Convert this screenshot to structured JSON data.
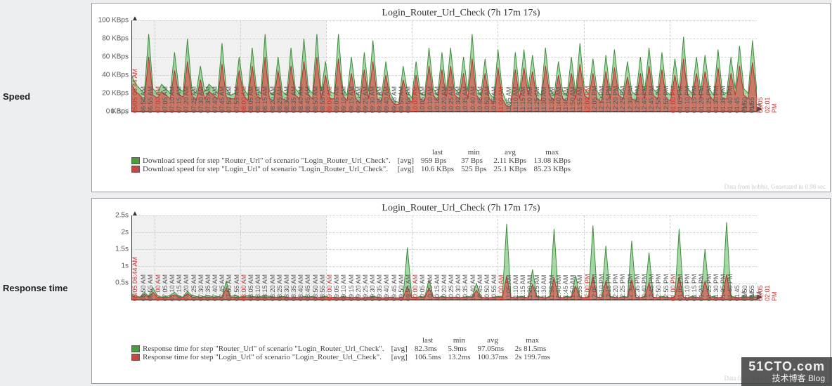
{
  "labels": {
    "speed": "Speed",
    "response": "Response time"
  },
  "brand": {
    "line1": "51CTO.com",
    "line2": "技术博客  Blog"
  },
  "watermark": "Data from hobbit, Generated in 0.98 sec",
  "chart_data": [
    {
      "type": "area",
      "title": "Login_Router_Url_Check (7h 17m 17s)",
      "ylabel": "Speed",
      "ylim": [
        0,
        100
      ],
      "yunit": "KBps",
      "yticks": [
        0,
        20,
        40,
        60,
        80,
        100
      ],
      "x_start": "05/05 06:44 AM",
      "x_end": "05/05 02:01 PM",
      "x_span_minutes": 437,
      "grey_until_minute": 136,
      "xticks": [
        {
          "label": "05/05 06:44 AM",
          "color": "red",
          "minute": 0
        },
        {
          "label": "06:50 AM",
          "minute": 6
        },
        {
          "label": "06:55 AM",
          "minute": 11
        },
        {
          "label": "07:00 AM",
          "color": "red",
          "minute": 16
        },
        {
          "label": "07:05 AM",
          "minute": 21
        },
        {
          "label": "07:10 AM",
          "minute": 26
        },
        {
          "label": "07:15 AM",
          "minute": 31
        },
        {
          "label": "07:20 AM",
          "minute": 36
        },
        {
          "label": "07:25 AM",
          "minute": 41
        },
        {
          "label": "07:30 AM",
          "minute": 46
        },
        {
          "label": "07:35 AM",
          "minute": 51
        },
        {
          "label": "07:40 AM",
          "minute": 56
        },
        {
          "label": "07:45 AM",
          "minute": 61
        },
        {
          "label": "07:50 AM",
          "minute": 66
        },
        {
          "label": "07:55 AM",
          "minute": 71
        },
        {
          "label": "08:00 AM",
          "color": "red",
          "minute": 76
        },
        {
          "label": "08:05 AM",
          "minute": 81
        },
        {
          "label": "08:10 AM",
          "minute": 86
        },
        {
          "label": "08:15 AM",
          "minute": 91
        },
        {
          "label": "08:20 AM",
          "minute": 96
        },
        {
          "label": "08:25 AM",
          "minute": 101
        },
        {
          "label": "08:30 AM",
          "minute": 106
        },
        {
          "label": "08:35 AM",
          "minute": 111
        },
        {
          "label": "08:40 AM",
          "minute": 116
        },
        {
          "label": "08:45 AM",
          "minute": 121
        },
        {
          "label": "08:50 AM",
          "minute": 126
        },
        {
          "label": "08:55 AM",
          "minute": 131
        },
        {
          "label": "09:00 AM",
          "color": "red",
          "minute": 136
        },
        {
          "label": "09:05 AM",
          "minute": 141
        },
        {
          "label": "09:10 AM",
          "minute": 146
        },
        {
          "label": "09:15 AM",
          "minute": 151
        },
        {
          "label": "09:20 AM",
          "minute": 156
        },
        {
          "label": "09:25 AM",
          "minute": 161
        },
        {
          "label": "09:30 AM",
          "minute": 166
        },
        {
          "label": "09:35 AM",
          "minute": 171
        },
        {
          "label": "09:40 AM",
          "minute": 176
        },
        {
          "label": "09:45 AM",
          "minute": 181
        },
        {
          "label": "09:50 AM",
          "minute": 186
        },
        {
          "label": "09:55 AM",
          "minute": 191
        },
        {
          "label": "10:00 AM",
          "color": "red",
          "minute": 196
        },
        {
          "label": "10:05 AM",
          "minute": 201
        },
        {
          "label": "10:10 AM",
          "minute": 206
        },
        {
          "label": "10:15 AM",
          "minute": 211
        },
        {
          "label": "10:20 AM",
          "minute": 216
        },
        {
          "label": "10:25 AM",
          "minute": 221
        },
        {
          "label": "10:30 AM",
          "minute": 226
        },
        {
          "label": "10:35 AM",
          "minute": 231
        },
        {
          "label": "10:40 AM",
          "minute": 236
        },
        {
          "label": "10:45 AM",
          "minute": 241
        },
        {
          "label": "10:50 AM",
          "minute": 246
        },
        {
          "label": "10:55 AM",
          "minute": 251
        },
        {
          "label": "11:00 AM",
          "color": "red",
          "minute": 256
        },
        {
          "label": "11:05 AM",
          "minute": 261
        },
        {
          "label": "11:10 AM",
          "minute": 266
        },
        {
          "label": "11:15 AM",
          "minute": 271
        },
        {
          "label": "11:20 AM",
          "minute": 276
        },
        {
          "label": "11:25 AM",
          "minute": 281
        },
        {
          "label": "11:30 AM",
          "minute": 286
        },
        {
          "label": "11:35 AM",
          "minute": 291
        },
        {
          "label": "11:40 AM",
          "minute": 296
        },
        {
          "label": "11:45 AM",
          "minute": 301
        },
        {
          "label": "11:50 AM",
          "minute": 306
        },
        {
          "label": "11:55 AM",
          "minute": 311
        },
        {
          "label": "12:00 PM",
          "color": "red",
          "minute": 316
        },
        {
          "label": "12:05 PM",
          "minute": 321
        },
        {
          "label": "12:10 PM",
          "minute": 326
        },
        {
          "label": "12:15 PM",
          "minute": 331
        },
        {
          "label": "12:20 PM",
          "minute": 336
        },
        {
          "label": "12:25 PM",
          "minute": 341
        },
        {
          "label": "12:30 PM",
          "minute": 346
        },
        {
          "label": "12:35 PM",
          "minute": 351
        },
        {
          "label": "12:40 PM",
          "minute": 356
        },
        {
          "label": "12:45 PM",
          "minute": 361
        },
        {
          "label": "12:50 PM",
          "minute": 366
        },
        {
          "label": "12:55 PM",
          "minute": 371
        },
        {
          "label": "01:00 PM",
          "color": "red",
          "minute": 376
        },
        {
          "label": "01:05 PM",
          "minute": 381
        },
        {
          "label": "01:10 PM",
          "minute": 386
        },
        {
          "label": "01:15 PM",
          "minute": 391
        },
        {
          "label": "01:20 PM",
          "minute": 396
        },
        {
          "label": "01:25 PM",
          "minute": 401
        },
        {
          "label": "01:30 PM",
          "minute": 406
        },
        {
          "label": "01:35 PM",
          "minute": 411
        },
        {
          "label": "01:40 PM",
          "minute": 416
        },
        {
          "label": "01:45 PM",
          "minute": 421
        },
        {
          "label": "01:50 PM",
          "minute": 426
        },
        {
          "label": "01:55 PM",
          "minute": 431
        },
        {
          "label": "05/05 02:01 PM",
          "color": "red",
          "minute": 437
        }
      ],
      "series": [
        {
          "name": "Download speed for step \"Router_Url\" of scenario \"Login_Router_Url_Check\".",
          "color": "#4a9e3a",
          "stats": {
            "last": "959 Bps",
            "min": "37 Bps",
            "avg": "2.11 KBps",
            "max": "13.08 KBps"
          }
        },
        {
          "name": "Download speed for step \"Login_Url\" of scenario \"Login_Router_Url_Check\".",
          "color": "#d9534f",
          "stats": {
            "last": "10.6 KBps",
            "min": "525 Bps",
            "avg": "25.1 KBps",
            "max": "85.23 KBps"
          }
        }
      ],
      "stat_headers": [
        "last",
        "min",
        "avg",
        "max"
      ],
      "stat_label": "[avg]",
      "green_values": [
        40,
        30,
        25,
        20,
        85,
        25,
        20,
        30,
        25,
        20,
        65,
        25,
        22,
        80,
        25,
        20,
        50,
        22,
        30,
        25,
        20,
        75,
        25,
        18,
        20,
        60,
        25,
        18,
        70,
        25,
        20,
        85,
        22,
        18,
        60,
        22,
        18,
        70,
        25,
        20,
        80,
        25,
        20,
        85,
        22,
        55,
        22,
        20,
        85,
        25,
        18,
        60,
        22,
        15,
        65,
        22,
        78,
        22,
        18,
        55,
        20,
        12,
        10,
        50,
        22,
        15,
        55,
        20,
        18,
        70,
        25,
        18,
        65,
        22,
        70,
        25,
        20,
        60,
        22,
        85,
        25,
        18,
        58,
        20,
        15,
        68,
        22,
        10,
        10,
        65,
        22,
        68,
        25,
        62,
        22,
        18,
        70,
        25,
        18,
        55,
        22,
        18,
        60,
        20,
        75,
        25,
        20,
        58,
        22,
        15,
        62,
        22,
        68,
        25,
        20,
        55,
        22,
        18,
        60,
        22,
        70,
        25,
        20,
        65,
        22,
        18,
        58,
        22,
        82,
        25,
        20,
        60,
        22,
        62,
        25,
        18,
        68,
        22,
        20,
        60,
        25,
        72,
        25,
        20,
        78,
        22
      ],
      "red_values": [
        30,
        22,
        18,
        12,
        60,
        18,
        15,
        22,
        18,
        14,
        45,
        18,
        16,
        55,
        18,
        12,
        35,
        14,
        22,
        18,
        14,
        52,
        16,
        14,
        14,
        45,
        18,
        12,
        50,
        18,
        14,
        60,
        14,
        12,
        45,
        14,
        12,
        50,
        18,
        14,
        55,
        18,
        14,
        60,
        14,
        40,
        14,
        14,
        58,
        18,
        12,
        42,
        14,
        10,
        46,
        14,
        55,
        14,
        12,
        40,
        14,
        8,
        8,
        35,
        16,
        10,
        40,
        14,
        12,
        50,
        18,
        12,
        46,
        16,
        50,
        18,
        14,
        42,
        14,
        58,
        18,
        12,
        42,
        14,
        10,
        48,
        14,
        6,
        6,
        46,
        14,
        48,
        18,
        44,
        14,
        12,
        50,
        18,
        12,
        40,
        14,
        12,
        42,
        14,
        52,
        18,
        14,
        42,
        14,
        10,
        44,
        14,
        48,
        18,
        14,
        38,
        14,
        12,
        42,
        14,
        50,
        18,
        14,
        46,
        14,
        12,
        40,
        14,
        58,
        18,
        14,
        42,
        14,
        44,
        18,
        12,
        48,
        14,
        14,
        42,
        18,
        50,
        18,
        14,
        54,
        14
      ]
    },
    {
      "type": "area",
      "title": "Login_Router_Url_Check (7h 17m 17s)",
      "ylabel": "Response time",
      "ylim": [
        0,
        2.5
      ],
      "yunit": "s",
      "yticks": [
        0.5,
        1.0,
        1.5,
        2.0,
        2.5
      ],
      "grey_until_minute": 136,
      "series": [
        {
          "name": "Response time for step \"Router_Url\" of scenario \"Login_Router_Url_Check\".",
          "color": "#4a9e3a",
          "stats": {
            "last": "82.3ms",
            "min": "5.9ms",
            "avg": "97.05ms",
            "max": "2s 81.5ms"
          }
        },
        {
          "name": "Response time for step \"Login_Url\" of scenario \"Login_Router_Url_Check\".",
          "color": "#d9534f",
          "stats": {
            "last": "106.5ms",
            "min": "13.2ms",
            "avg": "100.37ms",
            "max": "2s 199.7ms"
          }
        }
      ],
      "stat_headers": [
        "last",
        "min",
        "avg",
        "max"
      ],
      "stat_label": "[avg]",
      "green_values": [
        0.18,
        0.12,
        0.08,
        0.22,
        0.1,
        0.35,
        0.12,
        0.08,
        0.1,
        0.12,
        0.22,
        0.1,
        0.08,
        0.25,
        0.12,
        0.1,
        0.08,
        0.1,
        0.12,
        0.08,
        0.1,
        0.08,
        0.55,
        0.1,
        0.12,
        0.08,
        0.1,
        0.12,
        0.1,
        0.08,
        0.1,
        0.12,
        0.1,
        0.08,
        0.08,
        0.1,
        0.08,
        0.06,
        0.08,
        0.06,
        0.1,
        0.08,
        0.1,
        0.06,
        0.08,
        0.1,
        0.06,
        0.08,
        0.06,
        0.1,
        0.08,
        0.06,
        0.08,
        0.06,
        0.06,
        0.08,
        0.1,
        0.08,
        0.06,
        0.06,
        0.08,
        0.06,
        0.06,
        0.08,
        1.55,
        0.08,
        0.06,
        0.1,
        0.08,
        0.6,
        0.08,
        0.06,
        0.1,
        0.08,
        0.06,
        0.08,
        0.06,
        0.08,
        0.1,
        0.08,
        0.48,
        0.08,
        0.06,
        0.06,
        0.08,
        0.1,
        0.08,
        2.25,
        0.08,
        0.06,
        0.1,
        0.08,
        0.06,
        0.9,
        0.1,
        0.08,
        0.06,
        0.1,
        2.1,
        0.08,
        0.06,
        0.1,
        0.08,
        0.72,
        0.08,
        0.06,
        0.1,
        2.2,
        0.08,
        0.06,
        1.6,
        0.1,
        0.08,
        0.06,
        0.1,
        0.08,
        1.75,
        0.08,
        0.06,
        0.1,
        1.4,
        0.08,
        0.06,
        0.1,
        0.08,
        0.06,
        0.1,
        2.1,
        0.08,
        0.06,
        0.1,
        0.08,
        0.06,
        1.5,
        0.08,
        0.1,
        0.06,
        0.08,
        2.3,
        0.1,
        0.08,
        0.06,
        0.1,
        0.08,
        0.1,
        0.12
      ],
      "red_values": [
        0.12,
        0.08,
        0.06,
        0.16,
        0.07,
        0.22,
        0.08,
        0.06,
        0.07,
        0.08,
        0.15,
        0.07,
        0.06,
        0.18,
        0.08,
        0.07,
        0.06,
        0.07,
        0.08,
        0.06,
        0.07,
        0.06,
        0.35,
        0.07,
        0.08,
        0.06,
        0.07,
        0.08,
        0.07,
        0.06,
        0.07,
        0.08,
        0.07,
        0.06,
        0.06,
        0.07,
        0.06,
        0.05,
        0.06,
        0.05,
        0.07,
        0.06,
        0.07,
        0.05,
        0.06,
        0.07,
        0.05,
        0.06,
        0.05,
        0.07,
        0.06,
        0.05,
        0.06,
        0.05,
        0.05,
        0.06,
        0.07,
        0.06,
        0.05,
        0.05,
        0.06,
        0.05,
        0.05,
        0.06,
        0.4,
        0.06,
        0.05,
        0.07,
        0.06,
        0.35,
        0.06,
        0.05,
        0.07,
        0.06,
        0.05,
        0.06,
        0.05,
        0.06,
        0.07,
        0.06,
        0.28,
        0.06,
        0.05,
        0.05,
        0.06,
        0.07,
        0.06,
        0.7,
        0.06,
        0.05,
        0.07,
        0.06,
        0.05,
        0.45,
        0.07,
        0.06,
        0.05,
        0.07,
        0.65,
        0.06,
        0.05,
        0.07,
        0.06,
        0.4,
        0.06,
        0.05,
        0.07,
        0.7,
        0.06,
        0.05,
        0.55,
        0.07,
        0.06,
        0.05,
        0.07,
        0.06,
        0.6,
        0.06,
        0.05,
        0.07,
        0.5,
        0.06,
        0.05,
        0.07,
        0.06,
        0.05,
        0.07,
        0.68,
        0.06,
        0.05,
        0.07,
        0.06,
        0.05,
        0.55,
        0.06,
        0.07,
        0.05,
        0.06,
        0.75,
        0.07,
        0.06,
        0.05,
        0.07,
        0.06,
        0.07,
        0.08
      ]
    }
  ]
}
